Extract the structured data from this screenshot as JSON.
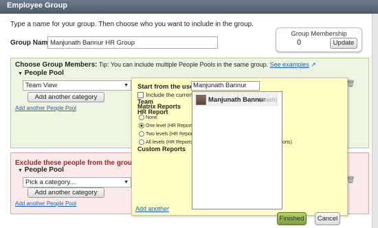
{
  "dialog": {
    "title": "Employee Group",
    "intro": "Type a name for your group. Then choose who you want to include in the group.",
    "group_name_label": "Group Name",
    "group_name_value": "Manjunath Bannur HR Group"
  },
  "membership": {
    "title": "Group Membership",
    "count": "0",
    "update_label": "Update"
  },
  "choose": {
    "heading": "Choose Group Members:",
    "tip": "Tip: You can include multiple People Pools in the same group.",
    "see_examples": "See examples",
    "pool_label": "People Pool",
    "category_value": "Team View",
    "add_category_label": "Add another category",
    "add_pool_link": "Add another People Pool"
  },
  "popup": {
    "start_label": "Start from the user:",
    "start_value": "Manjunath Bannur",
    "include_label": "Include the current u",
    "team": "Team",
    "matrix": "Matrix Reports",
    "hr_report": "HR Report",
    "radio_none": "None",
    "radio_one": "One level (HR Reports)",
    "radio_two": "Two levels (HR Reports",
    "radio_all": "All levels (HR Reports a",
    "radio_all_tail": "orts)",
    "custom": "Custom Reports",
    "add_another": "Add another"
  },
  "autocomplete": {
    "name": "Manjunath Bannur",
    "id": "(nnash)"
  },
  "exclude": {
    "heading": "Exclude these people from the group:",
    "pool_label": "People Pool",
    "category_placeholder": "Pick a category...",
    "add_category_label": "Add another category",
    "add_pool_link": "Add another People Pool"
  },
  "footer": {
    "finished_label": "Finished",
    "cancel_label": "Cancel"
  },
  "icons": {
    "expand": "triangle-down-icon",
    "trash": "trash-icon",
    "external": "external-link-icon"
  }
}
